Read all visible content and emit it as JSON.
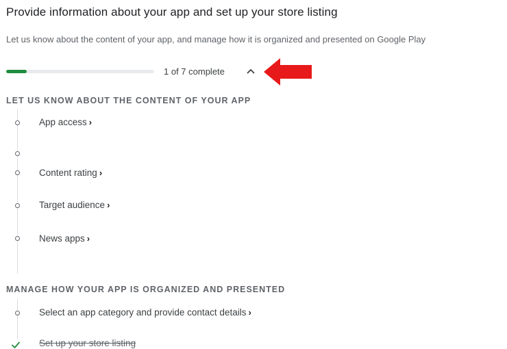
{
  "header": {
    "title": "Provide information about your app and set up your store listing",
    "subtitle": "Let us know about the content of your app, and manage how it is organized and presented on Google Play"
  },
  "progress": {
    "label": "1 of 7 complete",
    "completed": 1,
    "total": 7,
    "fill_fraction": 0.14,
    "fill_color": "#1e8e3e",
    "toggle_icon": "chevron-up-icon"
  },
  "annotation": {
    "icon": "red-arrow-icon",
    "color": "#e8191a"
  },
  "sections": [
    {
      "heading": "LET US KNOW ABOUT THE CONTENT OF YOUR APP",
      "steps": [
        {
          "label": "App access",
          "chevron": "›",
          "status": "pending"
        },
        {
          "label": "",
          "chevron": "",
          "status": "pending"
        },
        {
          "label": "Content rating",
          "chevron": "›",
          "status": "pending"
        },
        {
          "label": "Target audience",
          "chevron": "›",
          "status": "pending"
        },
        {
          "label": "News apps",
          "chevron": "›",
          "status": "pending"
        }
      ]
    },
    {
      "heading": "MANAGE HOW YOUR APP IS ORGANIZED AND PRESENTED",
      "steps": [
        {
          "label": "Select an app category and provide contact details",
          "chevron": "›",
          "status": "pending"
        },
        {
          "label": "Set up your store listing",
          "chevron": "",
          "status": "complete",
          "icon": "check-icon"
        }
      ]
    }
  ]
}
